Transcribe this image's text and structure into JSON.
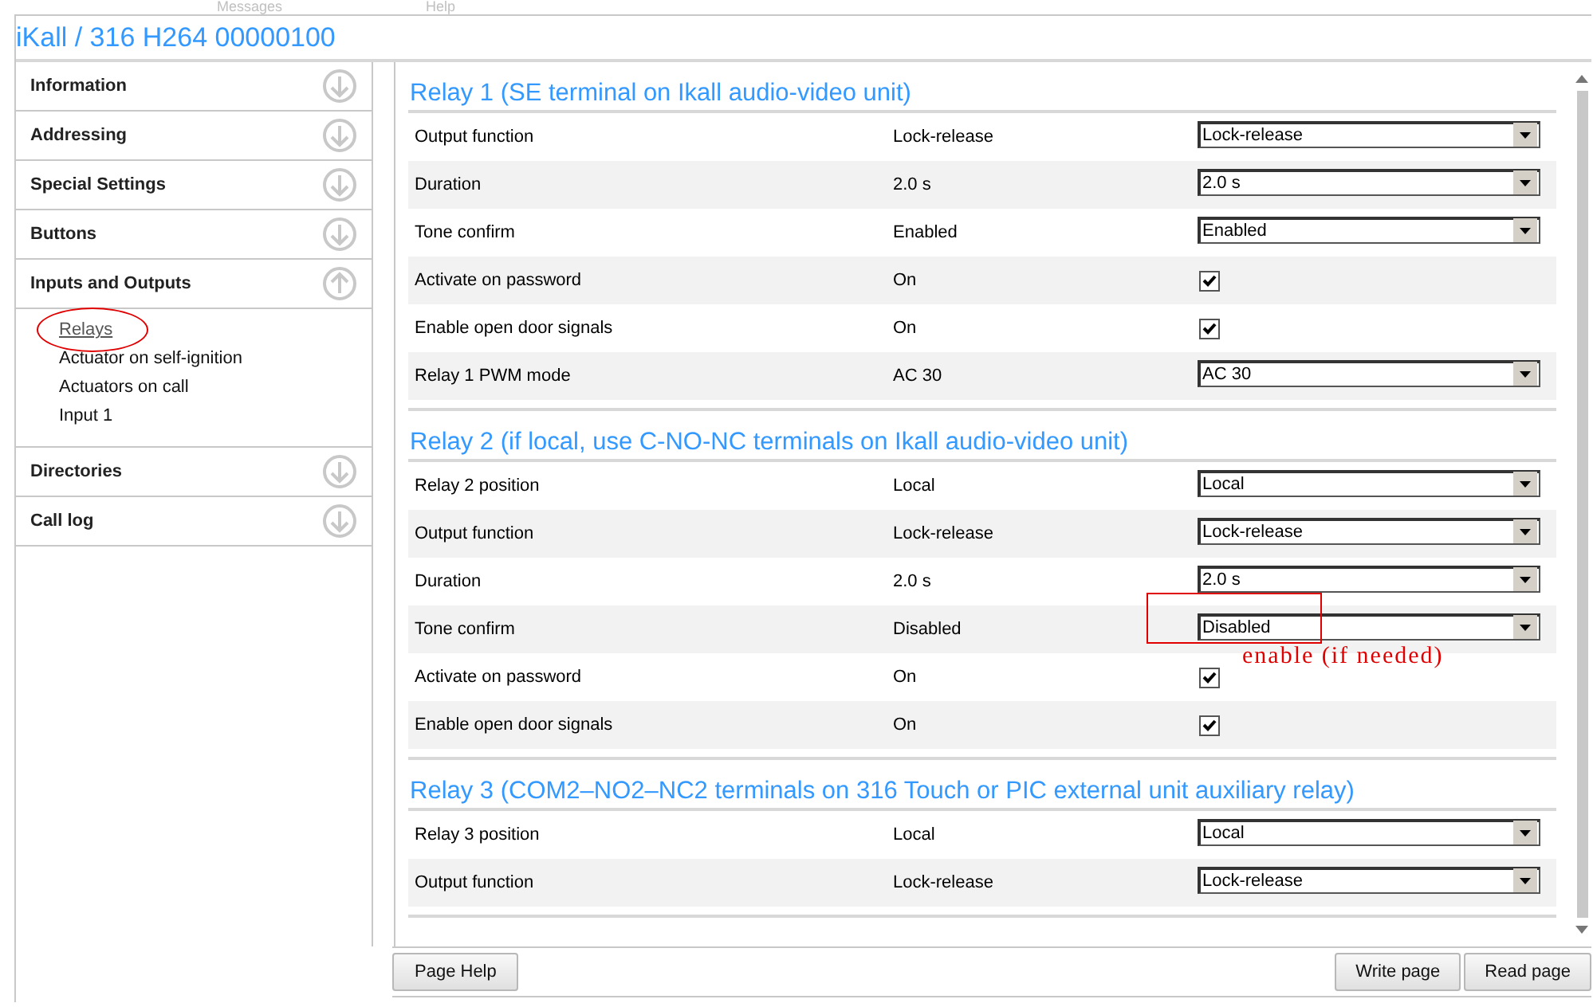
{
  "top_menu": [
    "Messages",
    "Help"
  ],
  "window": {
    "title": "iKall / 316 H264 00000100"
  },
  "sidebar": {
    "items": [
      {
        "label": "Information",
        "expanded": false
      },
      {
        "label": "Addressing",
        "expanded": false
      },
      {
        "label": "Special Settings",
        "expanded": false
      },
      {
        "label": "Buttons",
        "expanded": false
      },
      {
        "label": "Inputs and Outputs",
        "expanded": true,
        "children": [
          {
            "label": "Relays",
            "selected": true,
            "circled": true
          },
          {
            "label": "Actuator on self-ignition",
            "selected": false,
            "circled": false
          },
          {
            "label": "Actuators on call",
            "selected": false,
            "circled": false
          },
          {
            "label": "Input 1",
            "selected": false,
            "circled": false
          }
        ]
      },
      {
        "label": "Directories",
        "expanded": false
      },
      {
        "label": "Call log",
        "expanded": false
      }
    ]
  },
  "sections": [
    {
      "title": "Relay 1 (SE terminal on Ikall audio-video unit)",
      "rows": [
        {
          "label": "Output function",
          "value": "Lock-release",
          "control": {
            "kind": "select",
            "value": "Lock-release"
          }
        },
        {
          "label": "Duration",
          "value": "2.0 s",
          "control": {
            "kind": "select",
            "value": "2.0 s"
          }
        },
        {
          "label": "Tone confirm",
          "value": "Enabled",
          "control": {
            "kind": "select",
            "value": "Enabled"
          }
        },
        {
          "label": "Activate on password",
          "value": "On",
          "control": {
            "kind": "checkbox",
            "checked": true
          }
        },
        {
          "label": "Enable open door signals",
          "value": "On",
          "control": {
            "kind": "checkbox",
            "checked": true
          }
        },
        {
          "label": "Relay 1 PWM mode",
          "value": "AC 30",
          "control": {
            "kind": "select",
            "value": "AC 30"
          }
        }
      ]
    },
    {
      "title": "Relay 2 (if local, use C-NO-NC terminals on Ikall audio-video unit)",
      "rows": [
        {
          "label": "Relay 2 position",
          "value": "Local",
          "control": {
            "kind": "select",
            "value": "Local"
          }
        },
        {
          "label": "Output function",
          "value": "Lock-release",
          "control": {
            "kind": "select",
            "value": "Lock-release"
          }
        },
        {
          "label": "Duration",
          "value": "2.0 s",
          "control": {
            "kind": "select",
            "value": "2.0 s"
          }
        },
        {
          "label": "Tone confirm",
          "value": "Disabled",
          "control": {
            "kind": "select",
            "value": "Disabled"
          },
          "annotation": "enable (if needed)"
        },
        {
          "label": "Activate on password",
          "value": "On",
          "control": {
            "kind": "checkbox",
            "checked": true
          }
        },
        {
          "label": "Enable open door signals",
          "value": "On",
          "control": {
            "kind": "checkbox",
            "checked": true
          }
        }
      ]
    },
    {
      "title": "Relay 3 (COM2–NO2–NC2 terminals on 316 Touch or PIC external unit auxiliary relay)",
      "rows": [
        {
          "label": "Relay 3 position",
          "value": "Local",
          "control": {
            "kind": "select",
            "value": "Local"
          }
        },
        {
          "label": "Output function",
          "value": "Lock-release",
          "control": {
            "kind": "select",
            "value": "Lock-release"
          }
        }
      ]
    }
  ],
  "footer": {
    "left_buttons": [
      "Page Help"
    ],
    "right_buttons": [
      "Write page",
      "Read page"
    ]
  }
}
